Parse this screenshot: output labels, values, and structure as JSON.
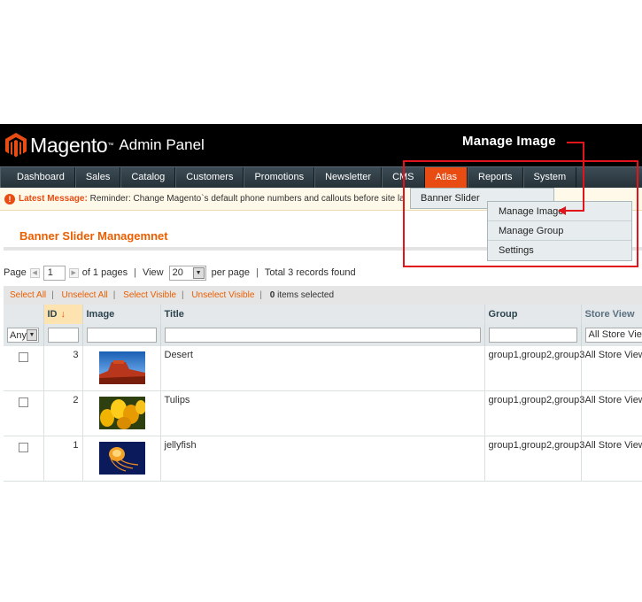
{
  "header": {
    "brand": "Magento",
    "trademark": "™",
    "subtitle": "Admin Panel",
    "annotation": "Manage  Image"
  },
  "nav": {
    "items": [
      {
        "label": "Dashboard"
      },
      {
        "label": "Sales"
      },
      {
        "label": "Catalog"
      },
      {
        "label": "Customers"
      },
      {
        "label": "Promotions"
      },
      {
        "label": "Newsletter"
      },
      {
        "label": "CMS"
      },
      {
        "label": "Atlas"
      },
      {
        "label": "Reports"
      },
      {
        "label": "System"
      }
    ],
    "active": "Atlas"
  },
  "dropdown": {
    "item": "Banner Slider",
    "submenu": [
      "Manage Image",
      "Manage Group",
      "Settings"
    ]
  },
  "message": {
    "label": "Latest Message:",
    "text": " Reminder: Change Magento`s default phone numbers and callouts before site la"
  },
  "page": {
    "title": "Banner Slider Managemnet"
  },
  "pager": {
    "page_label": "Page",
    "page_value": "1",
    "of_pages": "of 1 pages",
    "view_label": "View",
    "per_page_value": "20",
    "per_page_label": "per page",
    "total": "Total 3 records found"
  },
  "massaction": {
    "select_all": "Select All",
    "unselect_all": "Unselect All",
    "select_visible": "Select Visible",
    "unselect_visible": "Unselect Visible",
    "selected_count": "0",
    "selected_label": " items selected"
  },
  "grid": {
    "columns": {
      "id": "ID",
      "image": "Image",
      "title": "Title",
      "group": "Group",
      "store_view": "Store View"
    },
    "filter": {
      "any": "Any",
      "store_all": "All Store Views"
    },
    "rows": [
      {
        "id": "3",
        "title": "Desert",
        "group": "group1,group2,group3",
        "store": "All Store Views",
        "thumb": "desert"
      },
      {
        "id": "2",
        "title": "Tulips",
        "group": "group1,group2,group3",
        "store": "All Store Views",
        "thumb": "tulips"
      },
      {
        "id": "1",
        "title": "jellyfish",
        "group": "group1,group2,group3",
        "store": "All Store Views",
        "thumb": "jellyfish"
      }
    ]
  },
  "colors": {
    "accent": "#eb5e00",
    "annotation_red": "#e2141b",
    "nav_active": "#e84c13"
  }
}
